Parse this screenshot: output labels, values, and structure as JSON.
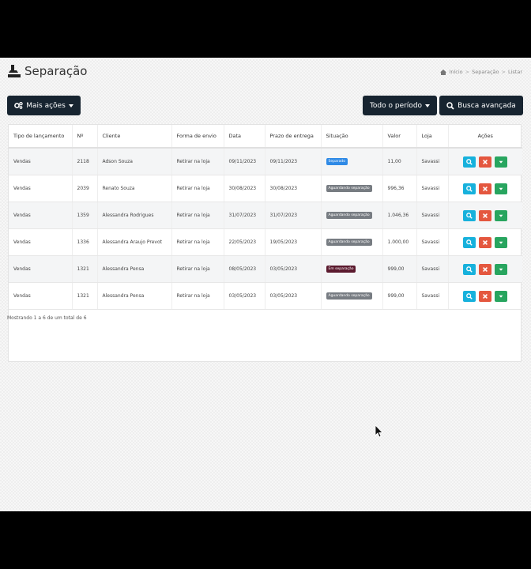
{
  "page": {
    "title": "Separação"
  },
  "breadcrumb": {
    "items": [
      "Início",
      "Separação",
      "Listar"
    ]
  },
  "toolbar": {
    "more_actions_label": "Mais ações",
    "period_label": "Todo o período",
    "advanced_search_label": "Busca avançada"
  },
  "table": {
    "headers": [
      "Tipo de lançamento",
      "Nº",
      "Cliente",
      "Forma de envio",
      "Data",
      "Prazo de entrega",
      "Situação",
      "Valor",
      "Loja",
      "Ações"
    ],
    "rows": [
      {
        "tipo": "Vendas",
        "numero": "2118",
        "cliente": "Adson Souza",
        "forma_envio": "Retirar na loja",
        "data": "09/11/2023",
        "prazo": "09/11/2023",
        "situacao": "Separado",
        "situacao_color": "#2f8ae6",
        "valor": "11,00",
        "loja": "Savassi"
      },
      {
        "tipo": "Vendas",
        "numero": "2039",
        "cliente": "Renato Souza",
        "forma_envio": "Retirar na loja",
        "data": "30/08/2023",
        "prazo": "30/08/2023",
        "situacao": "Aguardando separação",
        "situacao_color": "#777c82",
        "valor": "996,36",
        "loja": "Savassi"
      },
      {
        "tipo": "Vendas",
        "numero": "1359",
        "cliente": "Alessandra Rodrigues",
        "forma_envio": "Retirar na loja",
        "data": "31/07/2023",
        "prazo": "31/07/2023",
        "situacao": "Aguardando separação",
        "situacao_color": "#777c82",
        "valor": "1.046,36",
        "loja": "Savassi"
      },
      {
        "tipo": "Vendas",
        "numero": "1336",
        "cliente": "Alessandra Araujo Prevot",
        "forma_envio": "Retirar na loja",
        "data": "22/05/2023",
        "prazo": "19/05/2023",
        "situacao": "Aguardando separação",
        "situacao_color": "#777c82",
        "valor": "1.000,00",
        "loja": "Savassi"
      },
      {
        "tipo": "Vendas",
        "numero": "1321",
        "cliente": "Alessandra Pensa",
        "forma_envio": "Retirar na loja",
        "data": "08/05/2023",
        "prazo": "03/05/2023",
        "situacao": "Em separação",
        "situacao_color": "#5b1a2e",
        "valor": "999,00",
        "loja": "Savassi"
      },
      {
        "tipo": "Vendas",
        "numero": "1321",
        "cliente": "Alessandra Pensa",
        "forma_envio": "Retirar na loja",
        "data": "03/05/2023",
        "prazo": "03/05/2023",
        "situacao": "Aguardando separação",
        "situacao_color": "#777c82",
        "valor": "999,00",
        "loja": "Savassi"
      }
    ]
  },
  "footer": {
    "summary": "Mostrando 1 a 6 de um total de 6"
  },
  "colors": {
    "dark_button": "#172430",
    "view_button": "#17b1dc",
    "cancel_button": "#e4573f",
    "more_button": "#28a55f"
  },
  "icons": [
    "separation-icon",
    "home-icon",
    "gears-icon",
    "search-icon",
    "close-icon",
    "caret-down-icon",
    "cursor-arrow-icon"
  ]
}
